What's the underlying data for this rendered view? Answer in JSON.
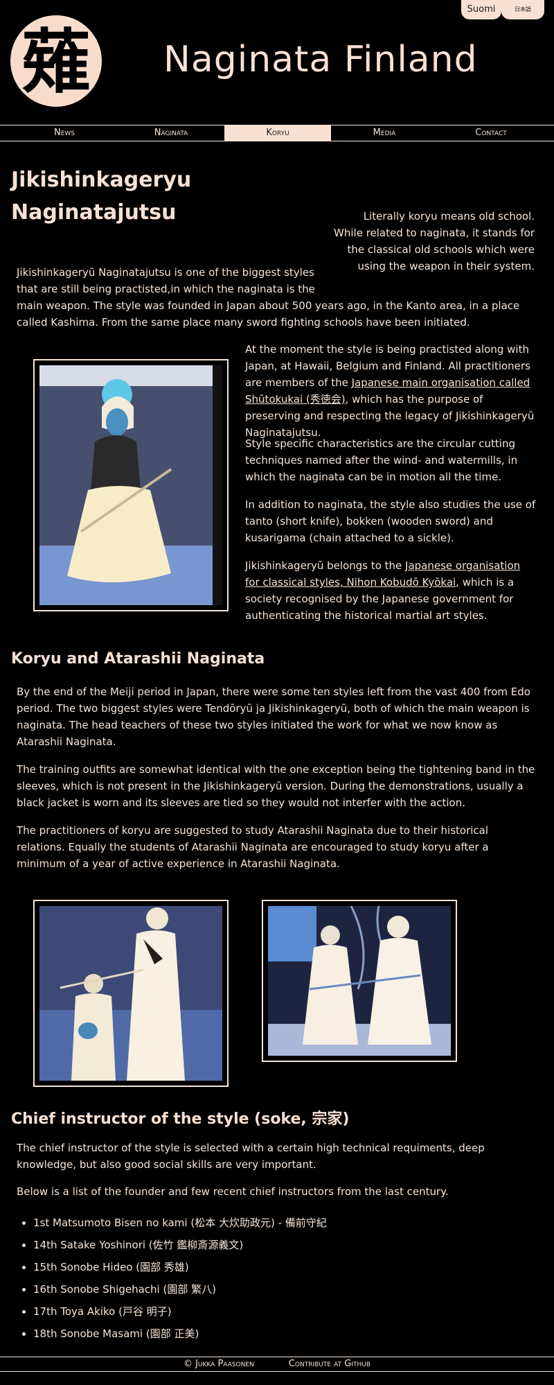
{
  "lang": {
    "finnish": "Suomi",
    "japanese": "日本語"
  },
  "site_title": "Naginata Finland",
  "logo_glyph": "薙",
  "nav": {
    "items": [
      "News",
      "Naginata",
      "Koryu",
      "Media",
      "Contact"
    ],
    "active_index": 2
  },
  "page_title": "Jikishinkageryu Naginatajutsu",
  "sidenote": "Literally koryu means old school. While related to naginata, it stands for the classical old schools which were using the weapon in their system.",
  "intro": "Jikishinkageryū Naginatajutsu is one of the biggest styles that are still being practisted,in which the naginata is the main weapon. The style was founded in Japan about 500 years ago, in the Kanto area, in a place called Kashima. From the same place many sword fighting schools have been initiated.",
  "p_moment": {
    "before": "At the moment the style is being practisted along with Japan, at Hawaii, Belgium and Finland. All practitioners are members of the ",
    "link": "Japanese main organisation called Shūtokukai (秀徳会)",
    "after": ", which has the purpose of preserving and respecting the legacy of Jikishinkageryū Naginatajutsu."
  },
  "p_characteristics": "Style specific characteristics are the circular cutting techniques named after the wind- and watermills, in which the naginata can be in motion all the time.",
  "p_tanto": "In addition to naginata, the style also studies the use of tanto (short knife), bokken (wooden sword) and kusarigama (chain attached to a sickle).",
  "p_belongs": {
    "before": "Jikishinkageryū belongs to the ",
    "link": "Japanese organisation for classical styles, Nihon Kobudō Kyōkai",
    "after": ", which is a society recognised by the Japanese government for authenticating the historical martial art styles."
  },
  "section2": {
    "title": "Koryu and Atarashii Naginata",
    "p1": "By the end of the Meiji period in Japan, there were some ten styles left from the vast 400 from Edo period. The two biggest styles were Tendōryū ja Jikishinkageryū, both of which the main weapon is naginata. The head teachers of these two styles initiated the work for what we now know as Atarashii Naginata.",
    "p2": "The training outfits are somewhat identical with the one exception being the tightening band in the sleeves, which is not present in the Jikishinkageryū version. During the demonstrations, usually a black jacket is worn and its sleeves are tied so they would not interfer with the action.",
    "p3": "The practitioners of koryu are suggested to study Atarashii Naginata due to their historical relations. Equally the students of Atarashii Naginata are encouraged to study koryu after a minimum of a year of active experience in Atarashii Naginata."
  },
  "section3": {
    "title": "Chief instructor of the style (soke, 宗家)",
    "p1": "The chief instructor of the style is selected with a certain high technical requiments, deep knowledge, but also good social skills are very important.",
    "p2": "Below is a list of the founder and few recent chief instructors from the last century.",
    "instructors": [
      "1st Matsumoto Bisen no kami (松本 大炊助政元) - 備前守紀",
      "14th Satake Yoshinori (佐竹 鑑柳斎源義文)",
      "15th Sonobe Hideo (園部 秀雄)",
      "16th Sonobe Shigehachi (園部 繁八)",
      "17th Toya Akiko (戸谷 明子)",
      "18th Sonobe Masami (園部 正美)"
    ]
  },
  "footer": {
    "author": "© Jukka Paasonen",
    "contribute": "Contribute at Github"
  }
}
